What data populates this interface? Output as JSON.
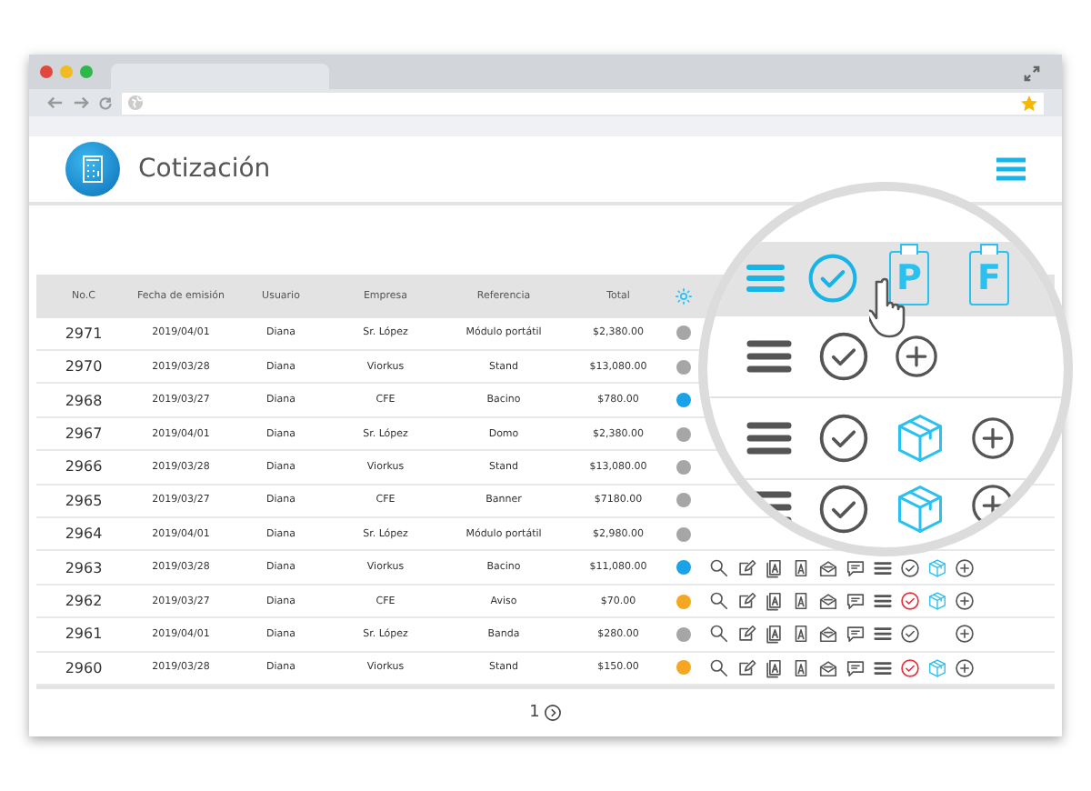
{
  "app": {
    "title": "Cotización"
  },
  "table": {
    "columns": [
      "No.C",
      "Fecha de emisión",
      "Usuario",
      "Empresa",
      "Referencia",
      "Total"
    ],
    "rows": [
      {
        "no": "2971",
        "date": "2019/04/01",
        "user": "Diana",
        "company": "Sr. López",
        "reference": "Módulo portátil",
        "total": "$2,380.00",
        "color": "#a6a6a6"
      },
      {
        "no": "2970",
        "date": "2019/03/28",
        "user": "Diana",
        "company": "Viorkus",
        "reference": "Stand",
        "total": "$13,080.00",
        "color": "#a6a6a6"
      },
      {
        "no": "2968",
        "date": "2019/03/27",
        "user": "Diana",
        "company": "CFE",
        "reference": "Bacino",
        "total": "$780.00",
        "color": "#1aa3e8"
      },
      {
        "no": "2967",
        "date": "2019/04/01",
        "user": "Diana",
        "company": "Sr. López",
        "reference": "Domo",
        "total": "$2,380.00",
        "color": "#a6a6a6"
      },
      {
        "no": "2966",
        "date": "2019/03/28",
        "user": "Diana",
        "company": "Viorkus",
        "reference": "Stand",
        "total": "$13,080.00",
        "color": "#a6a6a6"
      },
      {
        "no": "2965",
        "date": "2019/03/27",
        "user": "Diana",
        "company": "CFE",
        "reference": "Banner",
        "total": "$7180.00",
        "color": "#a6a6a6"
      },
      {
        "no": "2964",
        "date": "2019/04/01",
        "user": "Diana",
        "company": "Sr. López",
        "reference": "Módulo portátil",
        "total": "$2,980.00",
        "color": "#a6a6a6"
      },
      {
        "no": "2963",
        "date": "2019/03/28",
        "user": "Diana",
        "company": "Viorkus",
        "reference": "Bacino",
        "total": "$11,080.00",
        "color": "#1aa3e8",
        "actions": {
          "check_alert": false,
          "boxed": true
        }
      },
      {
        "no": "2962",
        "date": "2019/03/27",
        "user": "Diana",
        "company": "CFE",
        "reference": "Aviso",
        "total": "$70.00",
        "color": "#f5a623",
        "actions": {
          "check_alert": true,
          "boxed": true
        }
      },
      {
        "no": "2961",
        "date": "2019/04/01",
        "user": "Diana",
        "company": "Sr. López",
        "reference": "Banda",
        "total": "$280.00",
        "color": "#a6a6a6",
        "actions": {
          "check_alert": false,
          "boxed": false
        }
      },
      {
        "no": "2960",
        "date": "2019/03/28",
        "user": "Diana",
        "company": "Viorkus",
        "reference": "Stand",
        "total": "$150.00",
        "color": "#f5a623",
        "actions": {
          "check_alert": true,
          "boxed": true
        }
      }
    ]
  },
  "pagination": {
    "page": "1"
  },
  "magnifier": {
    "badges": [
      "P",
      "F"
    ],
    "rows": [
      {
        "boxed": false
      },
      {
        "boxed": true
      },
      {
        "boxed": true
      }
    ]
  }
}
